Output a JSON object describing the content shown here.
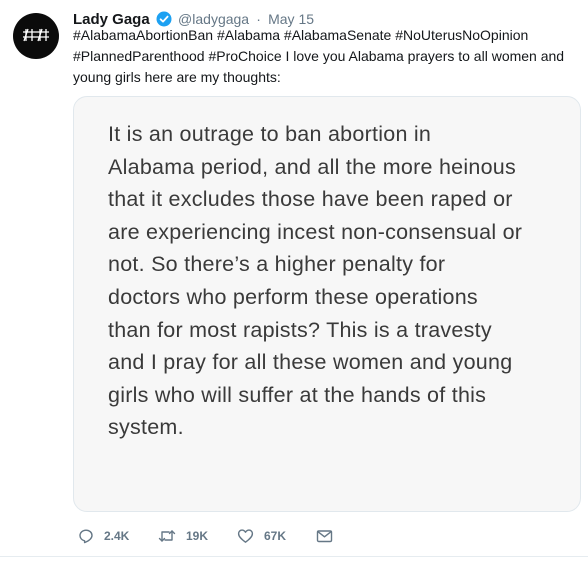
{
  "author": {
    "name": "Lady Gaga",
    "handle": "@ladygaga",
    "separator": "·",
    "date": "May 15"
  },
  "tweet": {
    "text": "#AlabamaAbortionBan #Alabama #AlabamaSenate #NoUterusNoOpinion #PlannedParenthood #ProChoice I love you Alabama prayers to all women and young girls here are my thoughts:"
  },
  "media": {
    "lines": [
      "It is an outrage to ban abortion in",
      "Alabama period, and all the more heinous",
      "that it excludes those have been raped or",
      "are experiencing incest non-consensual or",
      "not. So there’s a higher penalty for",
      "doctors who perform these operations",
      "than for most rapists? This is a travesty",
      "and I pray for all these women and young",
      "girls who will suffer at the hands of this",
      "system."
    ]
  },
  "actions": {
    "replies": "2.4K",
    "retweets": "19K",
    "likes": "67K"
  },
  "colors": {
    "text": "#14171a",
    "muted": "#657786",
    "verified": "#1da1f2",
    "note_bg": "#f7f7f7",
    "note_text": "#3a3a3a"
  },
  "icons": [
    "verified-badge-icon",
    "reply-icon",
    "retweet-icon",
    "like-icon",
    "direct-message-icon"
  ]
}
